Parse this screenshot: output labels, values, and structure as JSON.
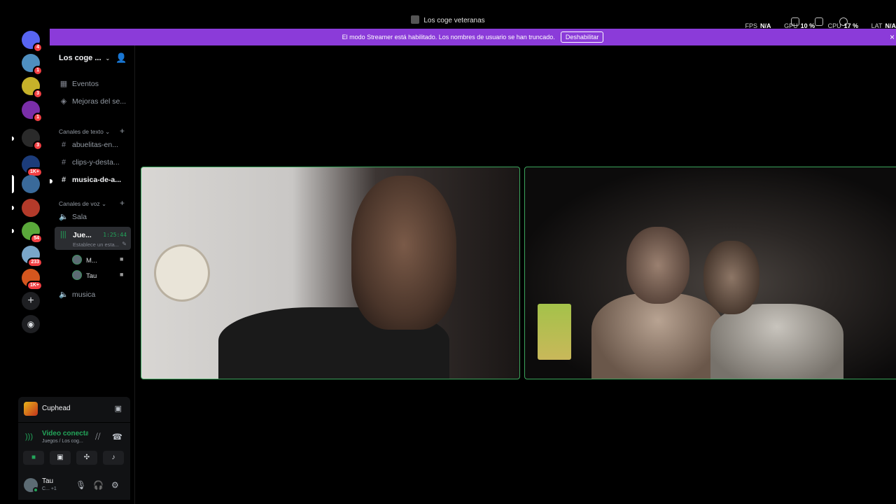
{
  "window": {
    "title": "Los coge veteranas",
    "stats": [
      {
        "label": "FPS",
        "value": "N/A"
      },
      {
        "label": "GPU",
        "value": "10 %"
      },
      {
        "label": "CPU",
        "value": "17 %"
      },
      {
        "label": "LAT",
        "value": "N/A"
      }
    ]
  },
  "banner": {
    "text": "El modo Streamer está habilitado. Los nombres de usuario se han truncado.",
    "button": "Deshabilitar",
    "close": "×"
  },
  "servers": [
    {
      "name": "discord-home",
      "badge": "4",
      "color": "#5865f2"
    },
    {
      "name": "server-1",
      "badge": "1",
      "color": "#4f8fc0"
    },
    {
      "name": "server-2",
      "badge": "3",
      "color": "#c6b22a"
    },
    {
      "name": "server-3",
      "badge": "1",
      "color": "#7a2ea8"
    },
    {
      "name": "server-4",
      "badge": "3",
      "color": "#2a2a2a"
    },
    {
      "name": "server-5",
      "badge": "1K+",
      "color": "#1c3c7a"
    },
    {
      "name": "server-6",
      "badge": "",
      "color": "#3a6a9a"
    },
    {
      "name": "server-7",
      "badge": "",
      "color": "#b33a2a"
    },
    {
      "name": "server-8",
      "badge": "54",
      "color": "#5aa83a"
    },
    {
      "name": "server-9",
      "badge": "233",
      "color": "#7aa6c9"
    },
    {
      "name": "server-10",
      "badge": "1K+",
      "color": "#d4561e"
    }
  ],
  "rail_buttons": {
    "add": "+",
    "explore": "◉"
  },
  "guild": {
    "name": "Los coge ...",
    "items": [
      {
        "label": "Eventos",
        "icon": "calendar-icon"
      },
      {
        "label": "Mejoras del se...",
        "icon": "boost-icon"
      }
    ],
    "text_category": "Canales de texto",
    "text_channels": [
      "abuelitas-en...",
      "clips-y-desta...",
      "musica-de-a..."
    ],
    "voice_category": "Canales de voz",
    "voice_channels": {
      "sala": "Sala",
      "active": {
        "name": "Jue...",
        "time": "1:25:44",
        "status": "Establece un esta..."
      },
      "members": [
        "M...",
        "Tau"
      ],
      "musica": "musica"
    }
  },
  "activity": {
    "game": "Cuphead"
  },
  "voice_panel": {
    "status": "Video conectado",
    "sub": "Juegos / Los cog..."
  },
  "user": {
    "name": "Tau",
    "sub": "C... +1"
  }
}
